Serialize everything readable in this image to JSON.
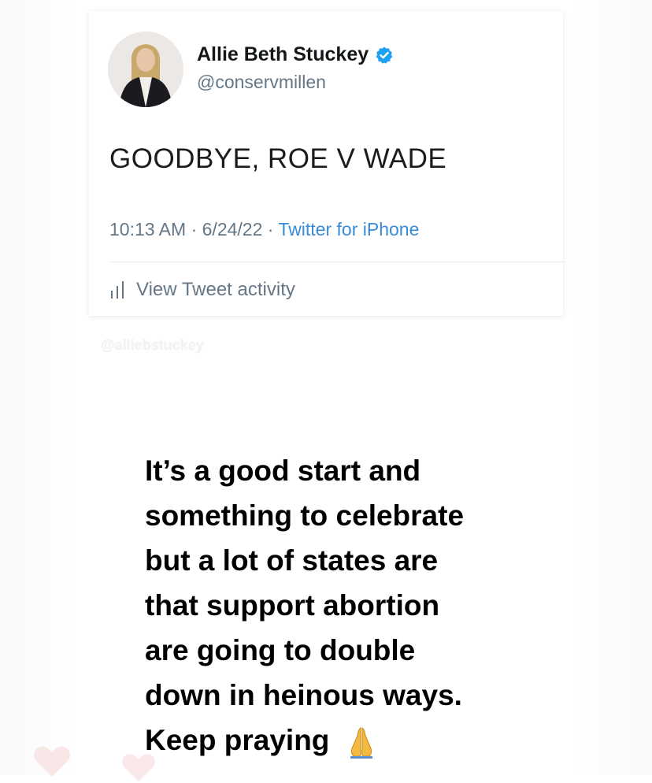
{
  "tweet": {
    "display_name": "Allie Beth Stuckey",
    "handle": "@conservmillen",
    "text": "GOODBYE, ROE V WADE",
    "time": "10:13 AM",
    "sep1": " · ",
    "date": "6/24/22",
    "sep2": " · ",
    "source": "Twitter for iPhone",
    "activity_label": "View Tweet activity",
    "verified_icon": "verified-badge-icon",
    "verified_color": "#1da1f2",
    "activity_icon": "bar-chart-icon"
  },
  "watermark": "@alliebstuckey",
  "caption": {
    "lines": [
      "It’s a good start and",
      "something to celebrate",
      "but a lot of states are",
      "that support abortion",
      "are going to double",
      "down in heinous ways.",
      "Keep praying"
    ],
    "emoji_icon": "folded-hands-icon"
  },
  "decor": {
    "heart_icon": "heart-icon",
    "heart_color": "#f6d6d6"
  }
}
